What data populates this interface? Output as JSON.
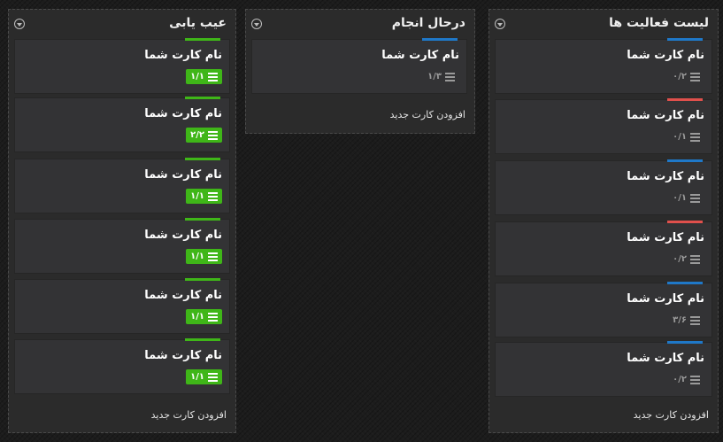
{
  "colors": {
    "done_green": "#3fb618",
    "stripe_green": "#3fb618",
    "stripe_blue": "#1f78c8",
    "stripe_red": "#e0504c",
    "background": "#1c1c1c",
    "list_bg": "#2b2b2b",
    "card_bg": "#333335"
  },
  "icons": {
    "collapse": "chevron-down-circle-icon",
    "checklist": "checklist-icon"
  },
  "lists": [
    {
      "title": "عیب یابی",
      "add_card_label": "افزودن کارت جدید",
      "cards": [
        {
          "title": "نام کارت شما",
          "checklist": "۱/۱",
          "complete": true,
          "label_color": "green"
        },
        {
          "title": "نام کارت شما",
          "checklist": "۲/۲",
          "complete": true,
          "label_color": "green"
        },
        {
          "title": "نام کارت شما",
          "checklist": "۱/۱",
          "complete": true,
          "label_color": "green"
        },
        {
          "title": "نام کارت شما",
          "checklist": "۱/۱",
          "complete": true,
          "label_color": "green"
        },
        {
          "title": "نام کارت شما",
          "checklist": "۱/۱",
          "complete": true,
          "label_color": "green"
        },
        {
          "title": "نام کارت شما",
          "checklist": "۱/۱",
          "complete": true,
          "label_color": "green"
        }
      ]
    },
    {
      "title": "درحال انجام",
      "add_card_label": "افزودن کارت جدید",
      "cards": [
        {
          "title": "نام کارت شما",
          "checklist": "۱/۳",
          "complete": false,
          "label_color": "blue"
        }
      ]
    },
    {
      "title": "لیست فعالیت ها",
      "add_card_label": "افزودن کارت جدید",
      "cards": [
        {
          "title": "نام کارت شما",
          "checklist": "۰/۲",
          "complete": false,
          "label_color": "blue"
        },
        {
          "title": "نام کارت شما",
          "checklist": "۰/۱",
          "complete": false,
          "label_color": "red"
        },
        {
          "title": "نام کارت شما",
          "checklist": "۰/۱",
          "complete": false,
          "label_color": "blue"
        },
        {
          "title": "نام کارت شما",
          "checklist": "۰/۲",
          "complete": false,
          "label_color": "red"
        },
        {
          "title": "نام کارت شما",
          "checklist": "۳/۶",
          "complete": false,
          "label_color": "blue"
        },
        {
          "title": "نام کارت شما",
          "checklist": "۰/۲",
          "complete": false,
          "label_color": "blue"
        }
      ]
    }
  ]
}
